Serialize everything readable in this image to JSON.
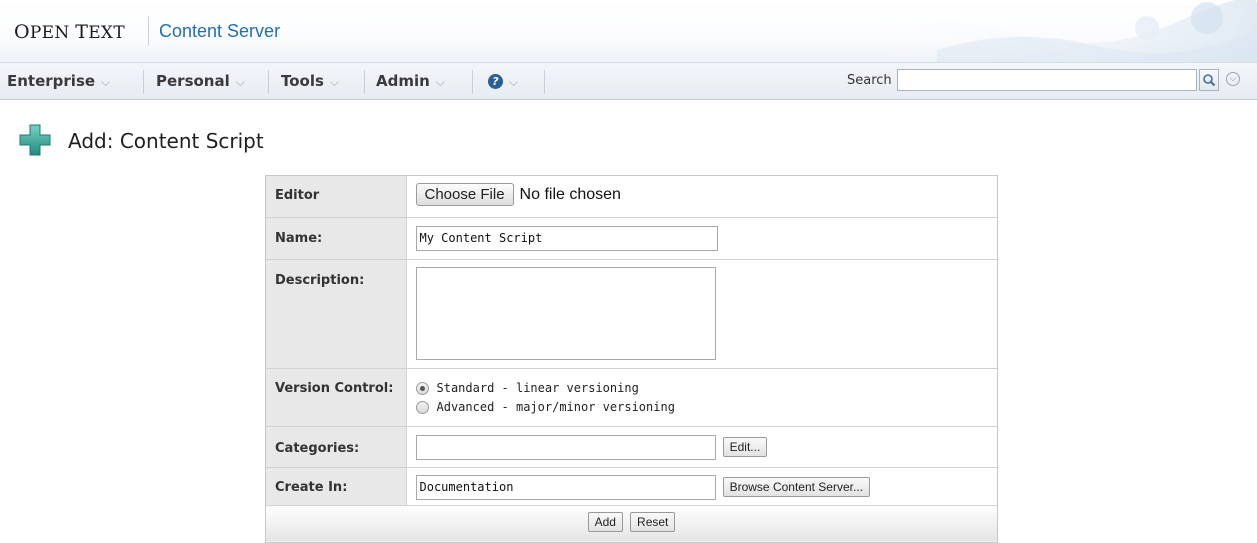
{
  "header": {
    "brand_first_big": "O",
    "brand_first_rest": "PEN",
    "brand_second_big": "T",
    "brand_second_rest": "EXT",
    "product": "Content Server"
  },
  "nav": {
    "items": [
      {
        "label": "Enterprise"
      },
      {
        "label": "Personal"
      },
      {
        "label": "Tools"
      },
      {
        "label": "Admin"
      }
    ],
    "help_glyph": "?",
    "search_label": "Search",
    "search_value": ""
  },
  "page": {
    "title": "Add: Content Script",
    "icon": "plus-icon"
  },
  "form": {
    "editor": {
      "label": "Editor",
      "button": "Choose File",
      "status": "No file chosen"
    },
    "name": {
      "label": "Name:",
      "value": "My Content Script"
    },
    "description": {
      "label": "Description:",
      "value": ""
    },
    "version_control": {
      "label": "Version Control:",
      "options": [
        {
          "label": "Standard - linear versioning",
          "selected": true
        },
        {
          "label": "Advanced - major/minor versioning",
          "selected": false
        }
      ]
    },
    "categories": {
      "label": "Categories:",
      "value": "",
      "button": "Edit..."
    },
    "create_in": {
      "label": "Create In:",
      "value": "Documentation",
      "button": "Browse Content Server..."
    },
    "actions": {
      "add": "Add",
      "reset": "Reset"
    }
  },
  "colors": {
    "brand_blue": "#1f6fb2",
    "plus_green": "#3aa89c"
  }
}
